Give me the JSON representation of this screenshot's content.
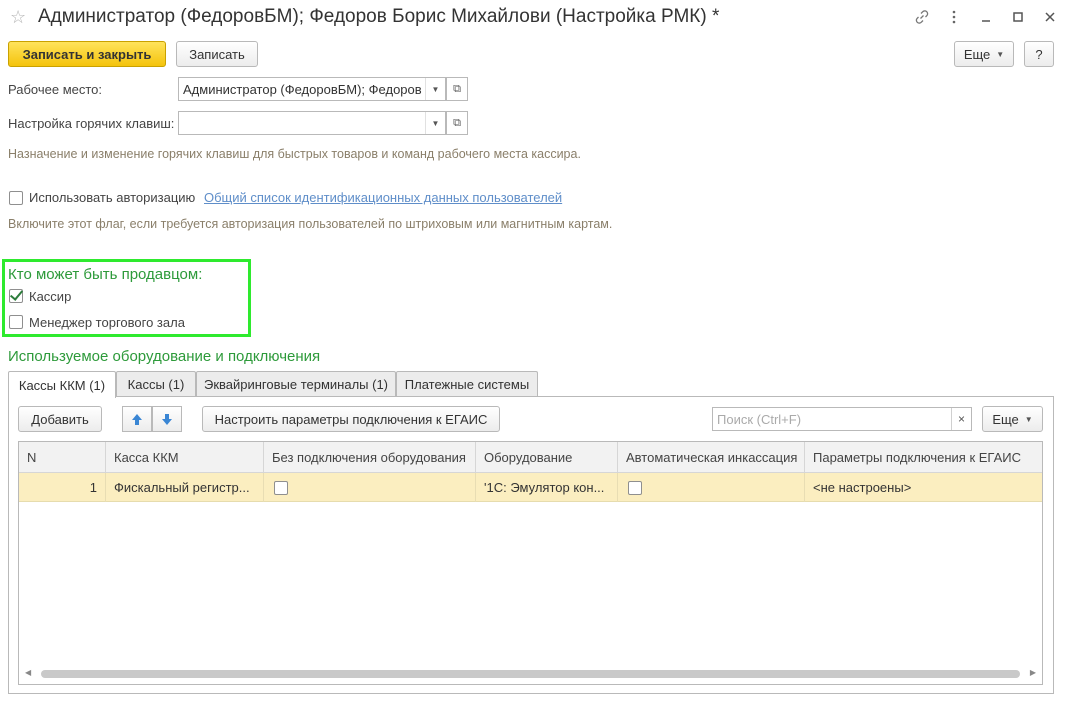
{
  "window": {
    "title": "Администратор (ФедоровБМ); Федоров Борис Михайлови (Настройка РМК) *",
    "icons": [
      "star-icon",
      "link-icon",
      "more-vertical-icon",
      "minimize-icon",
      "maximize-icon",
      "close-icon"
    ]
  },
  "toolbar": {
    "save_close_label": "Записать и закрыть",
    "save_label": "Записать",
    "more_label": "Еще",
    "help_label": "?"
  },
  "form": {
    "workplace_label": "Рабочее место:",
    "workplace_value": "Администратор (ФедоровБМ); Федоров",
    "hotkeys_label": "Настройка горячих клавиш:",
    "hotkeys_value": "",
    "hotkeys_hint": "Назначение и изменение горячих клавиш для быстрых товаров и команд рабочего места кассира.",
    "auth_label": "Использовать авторизацию",
    "auth_checked": false,
    "auth_link": "Общий список идентификационных данных пользователей",
    "auth_hint": "Включите этот флаг, если требуется авторизация пользователей по штриховым или магнитным картам."
  },
  "sellers": {
    "title": "Кто может быть продавцом:",
    "cashier_label": "Кассир",
    "cashier_checked": true,
    "manager_label": "Менеджер торгового зала",
    "manager_checked": false
  },
  "equipment": {
    "title": "Используемое оборудование и подключения",
    "tabs": [
      {
        "label": "Кассы ККМ (1)",
        "active": true
      },
      {
        "label": "Кассы (1)",
        "active": false
      },
      {
        "label": "Эквайринговые терминалы (1)",
        "active": false
      },
      {
        "label": "Платежные системы",
        "active": false
      }
    ],
    "add_label": "Добавить",
    "egais_label": "Настроить параметры подключения к ЕГАИС",
    "search_placeholder": "Поиск (Ctrl+F)",
    "clear_label": "×",
    "more_label": "Еще",
    "columns": [
      "N",
      "Касса ККМ",
      "Без подключения оборудования",
      "Оборудование",
      "Автоматическая инкассация",
      "Параметры подключения к ЕГАИС"
    ],
    "rows": [
      {
        "n": "1",
        "kkm": "Фискальный регистр...",
        "no_equipment": false,
        "equipment": "'1С: Эмулятор кон...",
        "auto_collection": false,
        "egais": "<не настроены>"
      }
    ]
  },
  "colors": {
    "primary_button": "#f4c30c",
    "section_title": "#2d9a3a",
    "highlight": "#2eea2e",
    "selected_row": "#fbeec0",
    "link": "#5f8ec9"
  }
}
